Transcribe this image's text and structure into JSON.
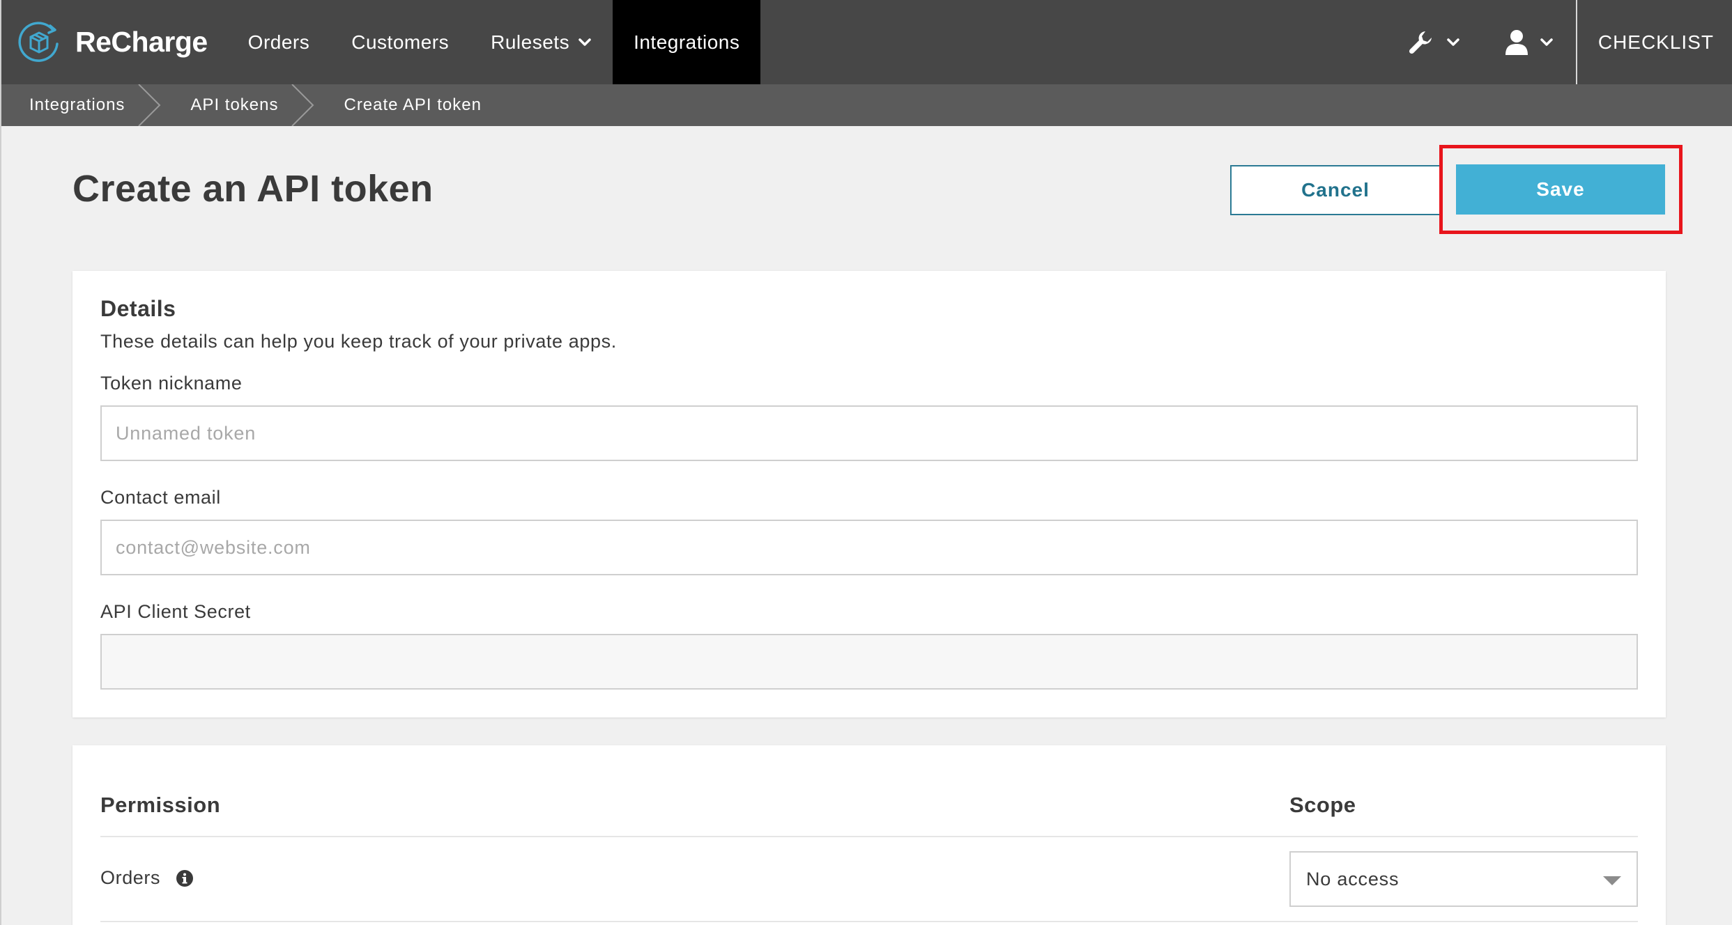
{
  "brand": {
    "name": "ReCharge",
    "logo_icon": "recharge-box-logo-icon"
  },
  "nav": {
    "items": [
      {
        "label": "Orders"
      },
      {
        "label": "Customers"
      },
      {
        "label": "Rulesets",
        "has_dropdown": true
      },
      {
        "label": "Integrations",
        "active": true
      }
    ],
    "tools_icon": "wrench-icon",
    "account_icon": "user-icon",
    "checklist_label": "CHECKLIST"
  },
  "breadcrumb": {
    "items": [
      "Integrations",
      "API tokens",
      "Create API token"
    ]
  },
  "header": {
    "title": "Create an API token",
    "cancel_label": "Cancel",
    "save_label": "Save"
  },
  "details": {
    "title": "Details",
    "description": "These details can help you keep track of your private apps.",
    "fields": [
      {
        "label": "Token nickname",
        "placeholder": "Unnamed token",
        "value": ""
      },
      {
        "label": "Contact email",
        "placeholder": "contact@website.com",
        "value": ""
      },
      {
        "label": "API Client Secret",
        "placeholder": "",
        "value": ""
      }
    ]
  },
  "permissions": {
    "permission_header": "Permission",
    "scope_header": "Scope",
    "rows": [
      {
        "label": "Orders",
        "scope": "No access"
      }
    ]
  },
  "colors": {
    "nav_bg": "#474747",
    "nav_active_bg": "#000000",
    "breadcrumb_bg": "#5b5b5b",
    "accent": "#42b0d5",
    "cancel_text": "#21728c",
    "highlight": "#e8151c"
  }
}
